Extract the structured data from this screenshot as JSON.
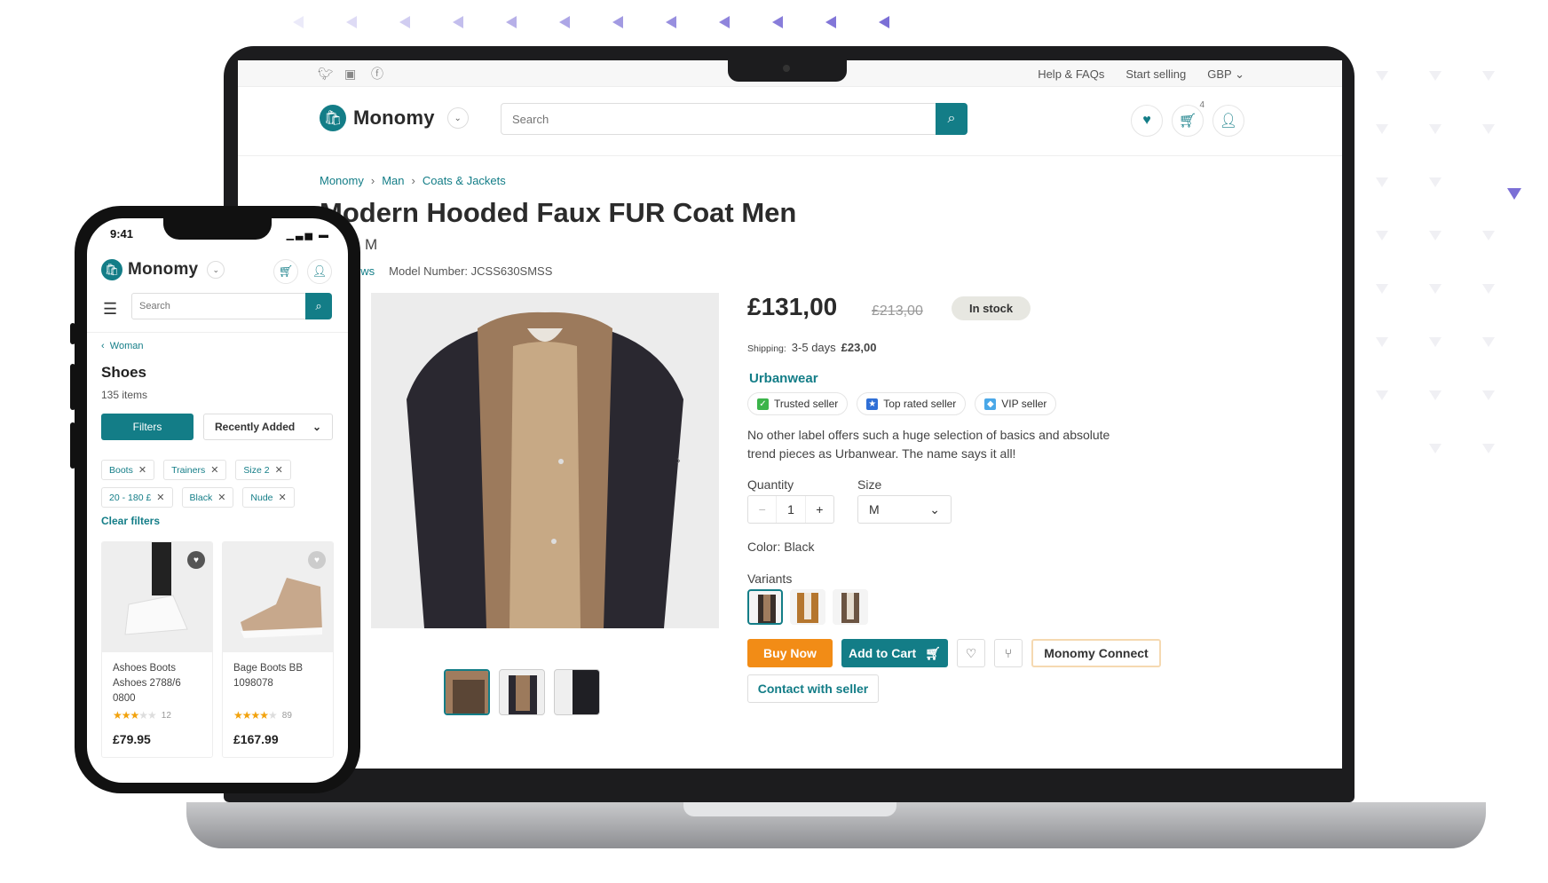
{
  "laptop": {
    "topbar": {
      "social": [
        "twitter-icon",
        "instagram-icon",
        "facebook-icon"
      ],
      "links": [
        "Help & FAQs",
        "Start selling"
      ],
      "currency": "GBP"
    },
    "header": {
      "brand": "Monomy",
      "search_placeholder": "Search",
      "cart_count": "4"
    },
    "breadcrumb": [
      "Monomy",
      "Man",
      "Coats & Jackets"
    ],
    "product": {
      "title": "Modern Hooded Faux FUR Coat Men",
      "subtitle": "Black, M",
      "reviews": "32 reviews",
      "model_label": "Model Number:",
      "model_value": "JCSS630SMSS",
      "price": "£131,00",
      "old_price": "£213,00",
      "stock": "In stock",
      "shipping_label": "Shipping:",
      "shipping_days": "3-5 days",
      "shipping_cost": "£23,00",
      "seller": "Urbanwear",
      "badges": [
        "Trusted seller",
        "Top rated seller",
        "VIP seller"
      ],
      "description": "No other label offers such a huge selection of basics and absolute trend pieces as Urbanwear. The name says it all!",
      "quantity_label": "Quantity",
      "quantity": "1",
      "size_label": "Size",
      "size": "M",
      "color_line": "Color: Black",
      "variants_label": "Variants",
      "buy_now": "Buy Now",
      "add_to_cart": "Add to Cart",
      "connect": "Monomy Connect",
      "contact": "Contact with seller"
    },
    "colors": {
      "brand": "#137d87",
      "buy": "#f28c16"
    }
  },
  "phone": {
    "time": "9:41",
    "brand": "Monomy",
    "search_placeholder": "Search",
    "back_label": "Woman",
    "title": "Shoes",
    "count": "135 items",
    "filters_label": "Filters",
    "sort_label": "Recently Added",
    "chips": [
      "Boots",
      "Trainers",
      "Size 2",
      "20 - 180 £",
      "Black",
      "Nude"
    ],
    "clear_filters": "Clear filters",
    "products": [
      {
        "name": "Ashoes Boots Ashoes 2788/6 0800",
        "rating": 3,
        "reviews": "12",
        "price": "£79.95"
      },
      {
        "name": "Bage Boots BB 1098078",
        "rating": 4,
        "reviews": "89",
        "price": "£167.99"
      }
    ]
  }
}
